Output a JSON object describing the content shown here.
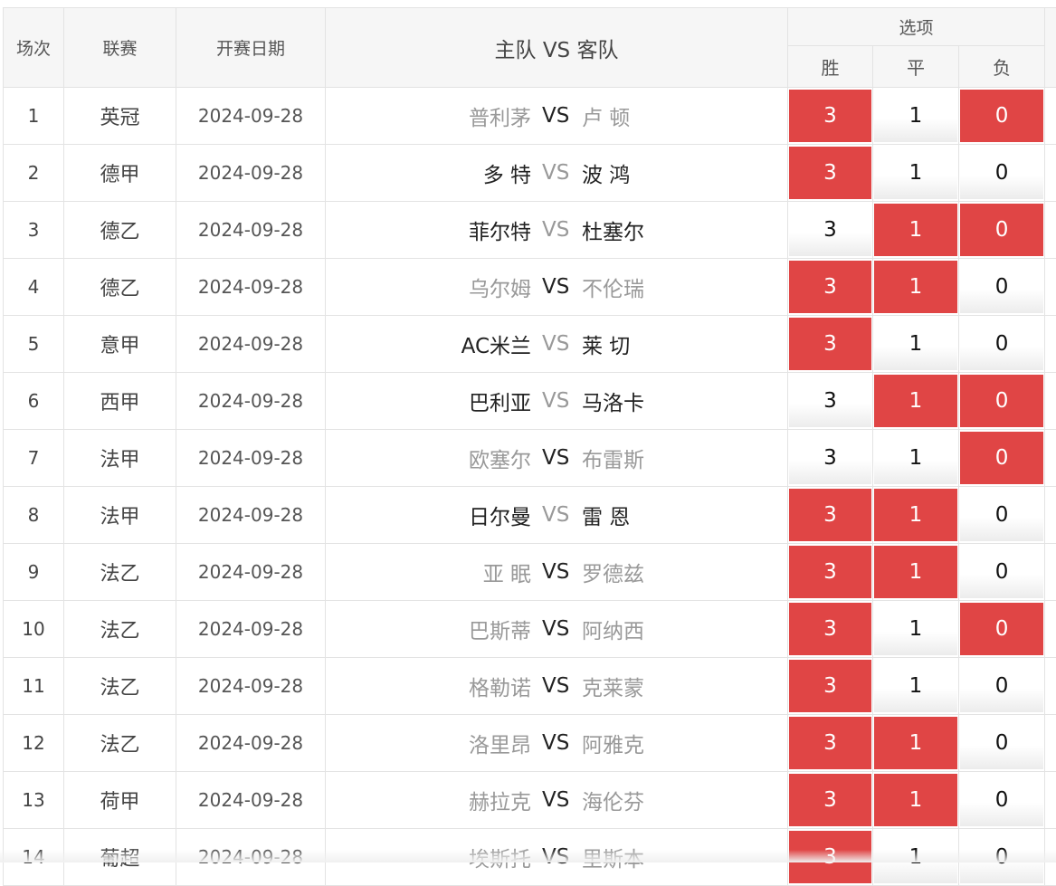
{
  "headers": {
    "round": "场次",
    "league": "联赛",
    "date": "开赛日期",
    "match": "主队 VS 客队",
    "options": "选项",
    "win": "胜",
    "draw": "平",
    "loss": "负"
  },
  "vs_label": "VS",
  "colors": {
    "selected": "#e04545",
    "muted": "#999999",
    "dark": "#222222"
  },
  "rows": [
    {
      "no": "1",
      "league": "英冠",
      "date": "2024-09-28",
      "home": "普利茅",
      "away": "卢 顿",
      "home_style": "grey",
      "vs_style": "dark",
      "away_style": "grey",
      "w": "3",
      "d": "1",
      "l": "0",
      "w_on": true,
      "d_on": false,
      "l_on": true
    },
    {
      "no": "2",
      "league": "德甲",
      "date": "2024-09-28",
      "home": "多 特",
      "away": "波 鸿",
      "home_style": "dark",
      "vs_style": "grey",
      "away_style": "dark",
      "w": "3",
      "d": "1",
      "l": "0",
      "w_on": true,
      "d_on": false,
      "l_on": false
    },
    {
      "no": "3",
      "league": "德乙",
      "date": "2024-09-28",
      "home": "菲尔特",
      "away": "杜塞尔",
      "home_style": "dark",
      "vs_style": "grey",
      "away_style": "dark",
      "w": "3",
      "d": "1",
      "l": "0",
      "w_on": false,
      "d_on": true,
      "l_on": true
    },
    {
      "no": "4",
      "league": "德乙",
      "date": "2024-09-28",
      "home": "乌尔姆",
      "away": "不伦瑞",
      "home_style": "grey",
      "vs_style": "dark",
      "away_style": "grey",
      "w": "3",
      "d": "1",
      "l": "0",
      "w_on": true,
      "d_on": true,
      "l_on": false
    },
    {
      "no": "5",
      "league": "意甲",
      "date": "2024-09-28",
      "home": "AC米兰",
      "away": "莱 切",
      "home_style": "dark",
      "vs_style": "grey",
      "away_style": "dark",
      "w": "3",
      "d": "1",
      "l": "0",
      "w_on": true,
      "d_on": false,
      "l_on": false
    },
    {
      "no": "6",
      "league": "西甲",
      "date": "2024-09-28",
      "home": "巴利亚",
      "away": "马洛卡",
      "home_style": "dark",
      "vs_style": "grey",
      "away_style": "dark",
      "w": "3",
      "d": "1",
      "l": "0",
      "w_on": false,
      "d_on": true,
      "l_on": true
    },
    {
      "no": "7",
      "league": "法甲",
      "date": "2024-09-28",
      "home": "欧塞尔",
      "away": "布雷斯",
      "home_style": "grey",
      "vs_style": "dark",
      "away_style": "grey",
      "w": "3",
      "d": "1",
      "l": "0",
      "w_on": false,
      "d_on": false,
      "l_on": true
    },
    {
      "no": "8",
      "league": "法甲",
      "date": "2024-09-28",
      "home": "日尔曼",
      "away": "雷 恩",
      "home_style": "dark",
      "vs_style": "grey",
      "away_style": "dark",
      "w": "3",
      "d": "1",
      "l": "0",
      "w_on": true,
      "d_on": true,
      "l_on": false
    },
    {
      "no": "9",
      "league": "法乙",
      "date": "2024-09-28",
      "home": "亚 眠",
      "away": "罗德兹",
      "home_style": "grey",
      "vs_style": "dark",
      "away_style": "grey",
      "w": "3",
      "d": "1",
      "l": "0",
      "w_on": true,
      "d_on": true,
      "l_on": false
    },
    {
      "no": "10",
      "league": "法乙",
      "date": "2024-09-28",
      "home": "巴斯蒂",
      "away": "阿纳西",
      "home_style": "grey",
      "vs_style": "dark",
      "away_style": "grey",
      "w": "3",
      "d": "1",
      "l": "0",
      "w_on": true,
      "d_on": false,
      "l_on": true
    },
    {
      "no": "11",
      "league": "法乙",
      "date": "2024-09-28",
      "home": "格勒诺",
      "away": "克莱蒙",
      "home_style": "grey",
      "vs_style": "dark",
      "away_style": "grey",
      "w": "3",
      "d": "1",
      "l": "0",
      "w_on": true,
      "d_on": false,
      "l_on": false
    },
    {
      "no": "12",
      "league": "法乙",
      "date": "2024-09-28",
      "home": "洛里昂",
      "away": "阿雅克",
      "home_style": "grey",
      "vs_style": "dark",
      "away_style": "grey",
      "w": "3",
      "d": "1",
      "l": "0",
      "w_on": true,
      "d_on": true,
      "l_on": false
    },
    {
      "no": "13",
      "league": "荷甲",
      "date": "2024-09-28",
      "home": "赫拉克",
      "away": "海伦芬",
      "home_style": "grey",
      "vs_style": "dark",
      "away_style": "grey",
      "w": "3",
      "d": "1",
      "l": "0",
      "w_on": true,
      "d_on": true,
      "l_on": false
    },
    {
      "no": "14",
      "league": "葡超",
      "date": "2024-09-28",
      "home": "埃斯托",
      "away": "里斯本",
      "home_style": "grey",
      "vs_style": "dark",
      "away_style": "grey",
      "w": "3",
      "d": "1",
      "l": "0",
      "w_on": true,
      "d_on": false,
      "l_on": false
    }
  ]
}
